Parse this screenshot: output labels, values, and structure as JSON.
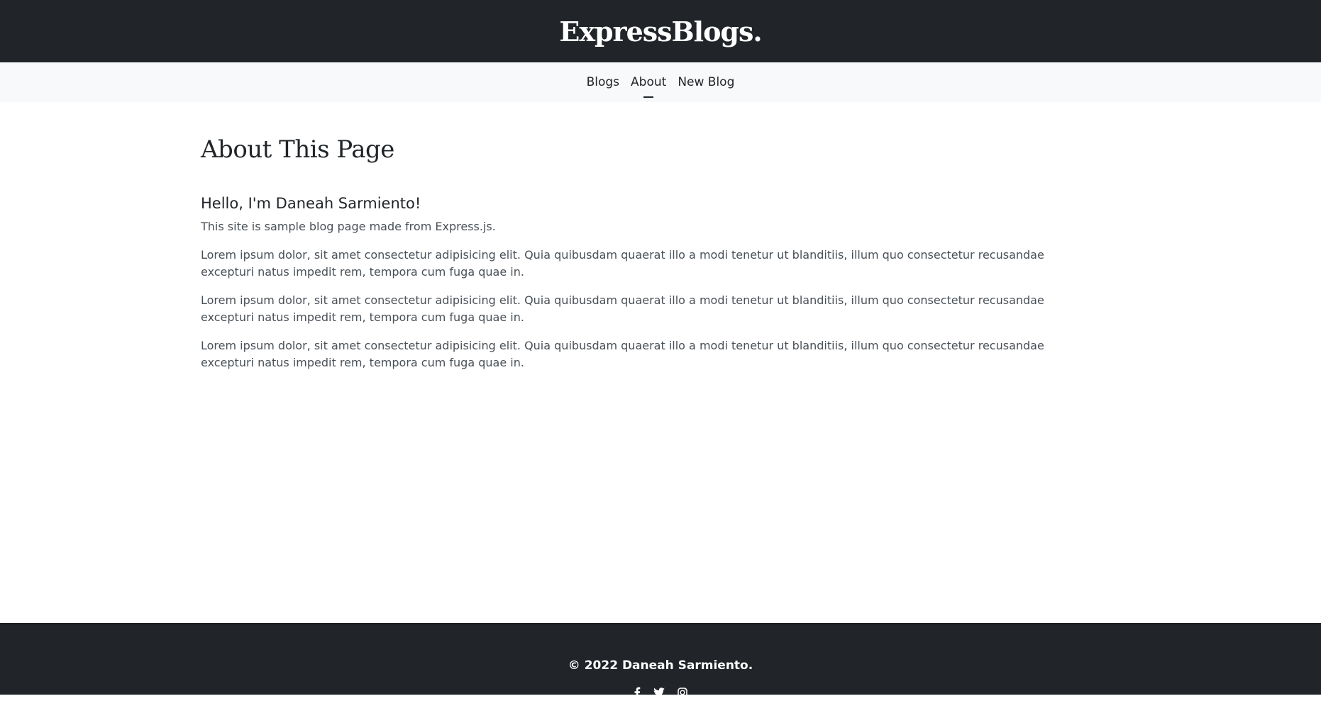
{
  "header": {
    "brand": "ExpressBlogs."
  },
  "nav": {
    "items": [
      {
        "label": "Blogs"
      },
      {
        "label": "About"
      },
      {
        "label": "New Blog"
      }
    ]
  },
  "main": {
    "title": "About This Page",
    "greeting": "Hello, I'm Daneah Sarmiento!",
    "intro": "This site is sample blog page made from Express.js.",
    "paragraphs": [
      "Lorem ipsum dolor, sit amet consectetur adipisicing elit. Quia quibusdam quaerat illo a modi tenetur ut blanditiis, illum quo consectetur recusandae excepturi natus impedit rem, tempora cum fuga quae in.",
      "Lorem ipsum dolor, sit amet consectetur adipisicing elit. Quia quibusdam quaerat illo a modi tenetur ut blanditiis, illum quo consectetur recusandae excepturi natus impedit rem, tempora cum fuga quae in.",
      "Lorem ipsum dolor, sit amet consectetur adipisicing elit. Quia quibusdam quaerat illo a modi tenetur ut blanditiis, illum quo consectetur recusandae excepturi natus impedit rem, tempora cum fuga quae in."
    ]
  },
  "footer": {
    "copyright": "© 2022 Daneah Sarmiento.",
    "social_icons": [
      "facebook-icon",
      "twitter-icon",
      "instagram-icon"
    ]
  },
  "colors": {
    "dark": "#212529",
    "light": "#f8f9fa"
  }
}
